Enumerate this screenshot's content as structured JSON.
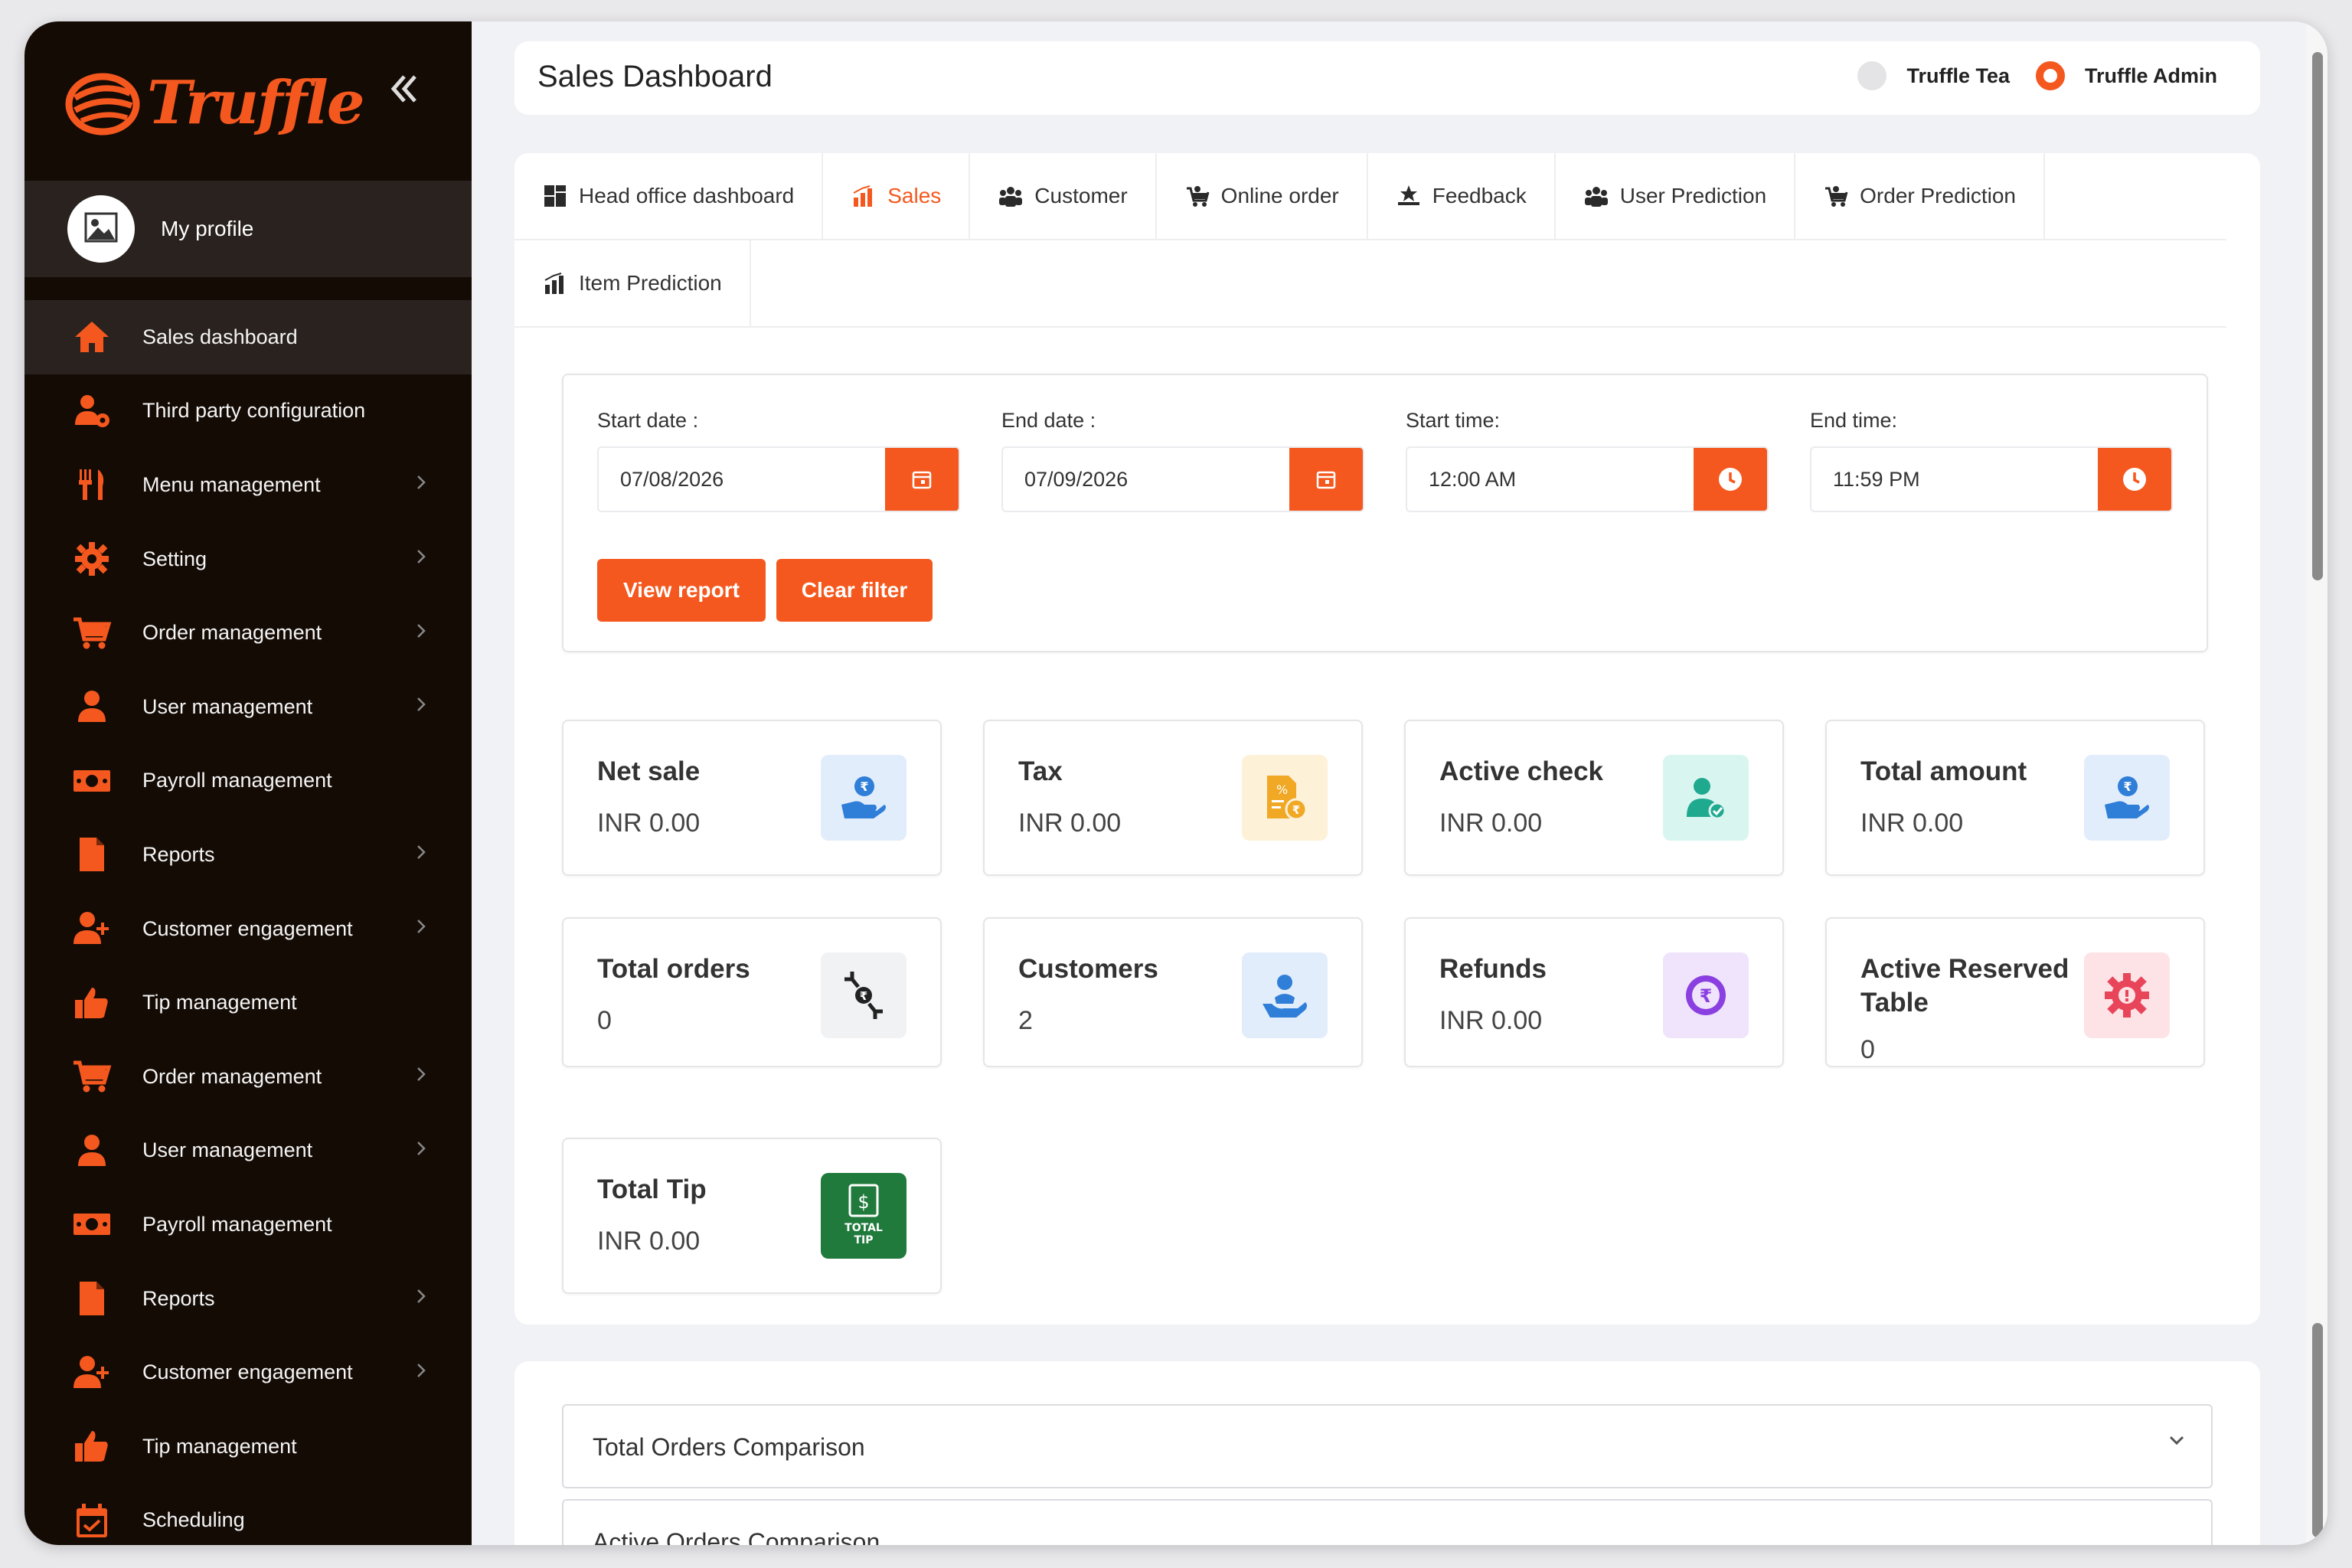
{
  "brand": {
    "name": "Truffle",
    "accent": "#f4581e",
    "sidebar_bg": "#140b05"
  },
  "sidebar": {
    "collapse_icon": "double-chevron-left-icon",
    "profile_label": "My profile",
    "items": [
      {
        "label": "Sales dashboard",
        "icon": "home-icon",
        "active": true,
        "has_submenu": false
      },
      {
        "label": "Third party configuration",
        "icon": "user-gear-icon",
        "active": false,
        "has_submenu": false
      },
      {
        "label": "Menu management",
        "icon": "cutlery-icon",
        "active": false,
        "has_submenu": true
      },
      {
        "label": "Setting",
        "icon": "gear-icon",
        "active": false,
        "has_submenu": true
      },
      {
        "label": "Order management",
        "icon": "cart-icon",
        "active": false,
        "has_submenu": true
      },
      {
        "label": "User management",
        "icon": "user-icon",
        "active": false,
        "has_submenu": true
      },
      {
        "label": "Payroll management",
        "icon": "money-icon",
        "active": false,
        "has_submenu": false
      },
      {
        "label": "Reports",
        "icon": "file-icon",
        "active": false,
        "has_submenu": true
      },
      {
        "label": "Customer engagement",
        "icon": "user-plus-icon",
        "active": false,
        "has_submenu": true
      },
      {
        "label": "Tip management",
        "icon": "thumbs-up-icon",
        "active": false,
        "has_submenu": false
      },
      {
        "label": "Order management",
        "icon": "cart-icon",
        "active": false,
        "has_submenu": true
      },
      {
        "label": "User management",
        "icon": "user-icon",
        "active": false,
        "has_submenu": true
      },
      {
        "label": "Payroll management",
        "icon": "money-icon",
        "active": false,
        "has_submenu": false
      },
      {
        "label": "Reports",
        "icon": "file-icon",
        "active": false,
        "has_submenu": true
      },
      {
        "label": "Customer engagement",
        "icon": "user-plus-icon",
        "active": false,
        "has_submenu": true
      },
      {
        "label": "Tip management",
        "icon": "thumbs-up-icon",
        "active": false,
        "has_submenu": false
      },
      {
        "label": "Scheduling",
        "icon": "calendar-icon",
        "active": false,
        "has_submenu": false
      }
    ]
  },
  "header": {
    "title": "Sales Dashboard",
    "options": [
      {
        "label": "Truffle Tea",
        "selected": false
      },
      {
        "label": "Truffle Admin",
        "selected": true
      }
    ]
  },
  "tabs": {
    "row1": [
      {
        "label": "Head office dashboard",
        "icon": "grid-icon",
        "active": false
      },
      {
        "label": "Sales",
        "icon": "bar-chart-icon",
        "active": true
      },
      {
        "label": "Customer",
        "icon": "users-icon",
        "active": false
      },
      {
        "label": "Online order",
        "icon": "cart-user-icon",
        "active": false
      },
      {
        "label": "Feedback",
        "icon": "stars-icon",
        "active": false
      },
      {
        "label": "User Prediction",
        "icon": "users-icon",
        "active": false
      },
      {
        "label": "Order Prediction",
        "icon": "cart-user-icon",
        "active": false
      }
    ],
    "row2": [
      {
        "label": "Item Prediction",
        "icon": "bar-chart-icon",
        "active": false
      }
    ]
  },
  "filters": {
    "start_date": {
      "label": "Start date :",
      "value": "07/08/2026",
      "icon": "calendar-icon"
    },
    "end_date": {
      "label": "End date :",
      "value": "07/09/2026",
      "icon": "calendar-icon"
    },
    "start_time": {
      "label": "Start time:",
      "value": "12:00 AM",
      "icon": "clock-icon"
    },
    "end_time": {
      "label": "End time:",
      "value": "11:59 PM",
      "icon": "clock-icon"
    },
    "view_report": "View report",
    "clear_filter": "Clear filter"
  },
  "stats": [
    {
      "title": "Net sale",
      "value": "INR 0.00",
      "icon": "hand-coin-icon",
      "icon_bg": "#e1edfb",
      "icon_color": "#2f7ed8"
    },
    {
      "title": "Tax",
      "value": "INR 0.00",
      "icon": "tax-document-icon",
      "icon_bg": "#fdf1d8",
      "icon_color": "#f0a825"
    },
    {
      "title": "Active check",
      "value": "INR 0.00",
      "icon": "user-check-icon",
      "icon_bg": "#d9f5f0",
      "icon_color": "#1fa98f"
    },
    {
      "title": "Total amount",
      "value": "INR 0.00",
      "icon": "hand-coin-icon",
      "icon_bg": "#e1edfb",
      "icon_color": "#2f7ed8"
    },
    {
      "title": "Total orders",
      "value": "0",
      "icon": "exchange-icon",
      "icon_bg": "#f1f2f4",
      "icon_color": "#222222"
    },
    {
      "title": "Customers",
      "value": "2",
      "icon": "customer-care-icon",
      "icon_bg": "#e1edfb",
      "icon_color": "#2f7ed8"
    },
    {
      "title": "Refunds",
      "value": "INR 0.00",
      "icon": "refund-icon",
      "icon_bg": "#efe4fb",
      "icon_color": "#8a3fe0"
    },
    {
      "title": "Active Reserved Table",
      "value": "0",
      "icon": "gear-alert-icon",
      "icon_bg": "#fde3e6",
      "icon_color": "#e8455a"
    },
    {
      "title": "Total Tip",
      "value": "INR 0.00",
      "icon": "total-tip-icon",
      "icon_bg": "#1f7a3c",
      "icon_color": "#ffffff",
      "icon_text": "TOTAL TIP"
    }
  ],
  "accordions": [
    {
      "title": "Total Orders Comparison"
    },
    {
      "title": "Active Orders Comparison"
    }
  ]
}
